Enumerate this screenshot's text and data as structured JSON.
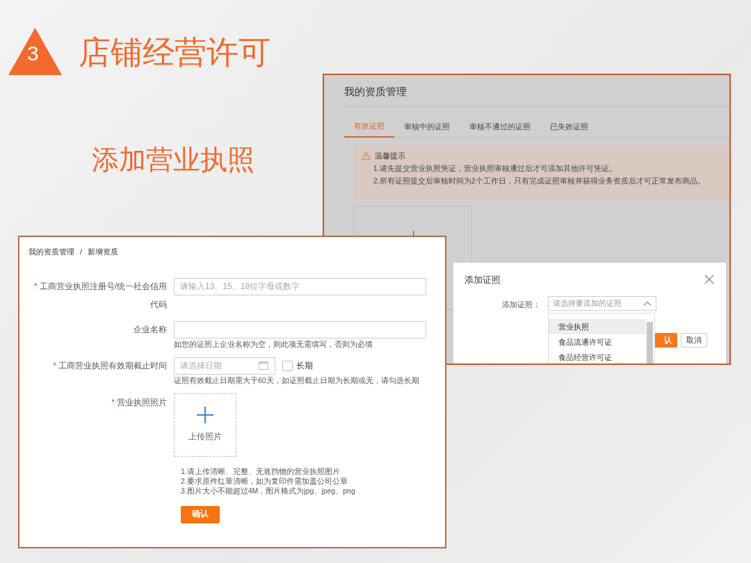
{
  "slide": {
    "step_number": "3",
    "title": "店铺经营许可",
    "subtitle": "添加营业执照"
  },
  "qualification_page": {
    "title": "我的资质管理",
    "tabs": [
      {
        "label": "有效证照",
        "selected": true
      },
      {
        "label": "审核中的证照",
        "selected": false
      },
      {
        "label": "审核不通过的证照",
        "selected": false
      },
      {
        "label": "已失效证照",
        "selected": false
      }
    ],
    "notice": {
      "heading": "温馨提示",
      "lines": [
        "1.请先提交营业执照凭证，营业执照审核通过后才可添加其他许可凭证。",
        "2.所有证照提交后审核时间为2个工作日，只有完成证照审核并获得业务资质后才可正常发布商品。"
      ]
    },
    "dialog": {
      "title": "添加证照",
      "field_label": "添加证照：",
      "select": {
        "placeholder": "请选择要添加的证照",
        "expanded": true
      },
      "options": [
        {
          "label": "营业执照",
          "selected": true
        },
        {
          "label": "食品流通许可证",
          "selected": false
        },
        {
          "label": "食品经营许可证",
          "selected": false
        }
      ],
      "buttons": [
        {
          "label": "认",
          "kind": "primary"
        },
        {
          "label": "取消",
          "kind": "default"
        }
      ]
    }
  },
  "add_form": {
    "breadcrumb": {
      "items": [
        "我的资质管理",
        "新增资质"
      ],
      "separator": "/"
    },
    "fields": [
      {
        "kind": "text",
        "label": "工商营业执照注册号/统一社会信用代码",
        "required_mark": "*",
        "placeholder": "请输入13、15、18位字母或数字"
      },
      {
        "kind": "text",
        "label": "企业名称",
        "help": "如您的证照上企业名称为空，则此项无需填写，否则为必填"
      },
      {
        "kind": "date",
        "label": "工商营业执照有效期截止时间",
        "required_mark": "*",
        "placeholder": "请选择日期",
        "checkbox": {
          "label": "长期",
          "checked": false
        },
        "help": "证照有效截止日期需大于60天，如证照截止日期为长期或无，请勾选长期"
      },
      {
        "kind": "upload",
        "label": "营业执照照片",
        "required_mark": "*",
        "upload_label": "上传照片"
      }
    ],
    "notes": [
      "1.请上传清晰、完整、无遮挡物的营业执照图片",
      "2.要求原件红章清晰，如为复印件需加盖公司公章",
      "3.图片大小不能超过4M，图片格式为jpg、jpeg、png"
    ],
    "submit": "确认"
  }
}
